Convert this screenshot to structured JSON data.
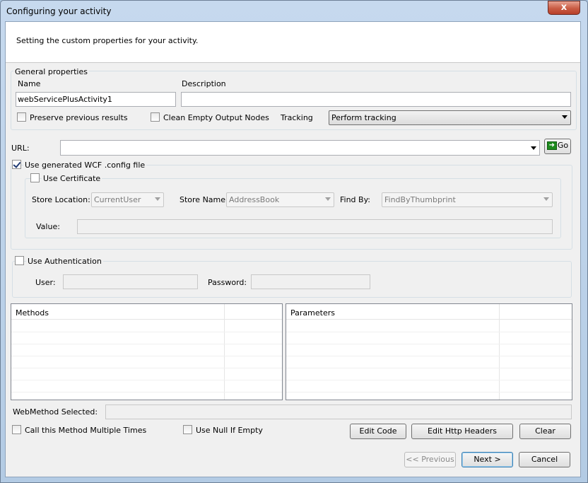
{
  "window": {
    "title": "Configuring your activity",
    "close_glyph": "x"
  },
  "header": {
    "text": "Setting the custom properties for your activity."
  },
  "general": {
    "group_label": "General properties",
    "name_label": "Name",
    "name_value": "webServicePlusActivity1",
    "description_label": "Description",
    "description_value": "",
    "preserve_label": "Preserve previous results",
    "preserve_checked": false,
    "clean_label": "Clean Empty Output Nodes",
    "clean_checked": false,
    "tracking_label": "Tracking",
    "tracking_value": "Perform tracking"
  },
  "url": {
    "label": "URL:",
    "value": "",
    "go_label": "Go"
  },
  "wcf": {
    "label": "Use generated WCF .config file",
    "checked": true
  },
  "certificate": {
    "label": "Use Certificate",
    "checked": false,
    "store_location_label": "Store Location:",
    "store_location_value": "CurrentUser",
    "store_name_label": "Store Name:",
    "store_name_value": "AddressBook",
    "find_by_label": "Find By:",
    "find_by_value": "FindByThumbprint",
    "value_label": "Value:",
    "value_value": ""
  },
  "auth": {
    "label": "Use Authentication",
    "checked": false,
    "user_label": "User:",
    "user_value": "",
    "password_label": "Password:",
    "password_value": ""
  },
  "methods": {
    "header": "Methods"
  },
  "parameters": {
    "header": "Parameters"
  },
  "webmethod": {
    "label": "WebMethod Selected:",
    "value": ""
  },
  "options": {
    "multiple_label": "Call this Method Multiple Times",
    "null_label": "Use Null If Empty"
  },
  "buttons": {
    "edit_code": "Edit Code",
    "edit_headers": "Edit Http Headers",
    "clear": "Clear",
    "previous": "<< Previous",
    "next": "Next >",
    "cancel": "Cancel"
  },
  "colors": {
    "accent": "#3c7fb1",
    "go_green": "#1d8a1d",
    "close_red": "#c95c44"
  }
}
